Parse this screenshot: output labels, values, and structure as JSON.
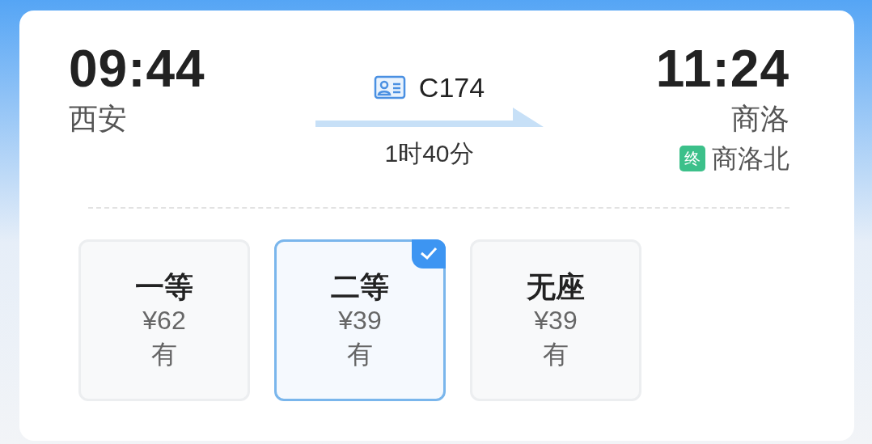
{
  "departure": {
    "time": "09:44",
    "station": "西安"
  },
  "train": {
    "number": "C174",
    "duration": "1时40分"
  },
  "arrival": {
    "time": "11:24",
    "station": "商洛",
    "terminal_badge": "终",
    "terminal_station": "商洛北"
  },
  "seats": [
    {
      "class": "一等",
      "price": "¥62",
      "availability": "有",
      "selected": false
    },
    {
      "class": "二等",
      "price": "¥39",
      "availability": "有",
      "selected": true
    },
    {
      "class": "无座",
      "price": "¥39",
      "availability": "有",
      "selected": false
    }
  ]
}
